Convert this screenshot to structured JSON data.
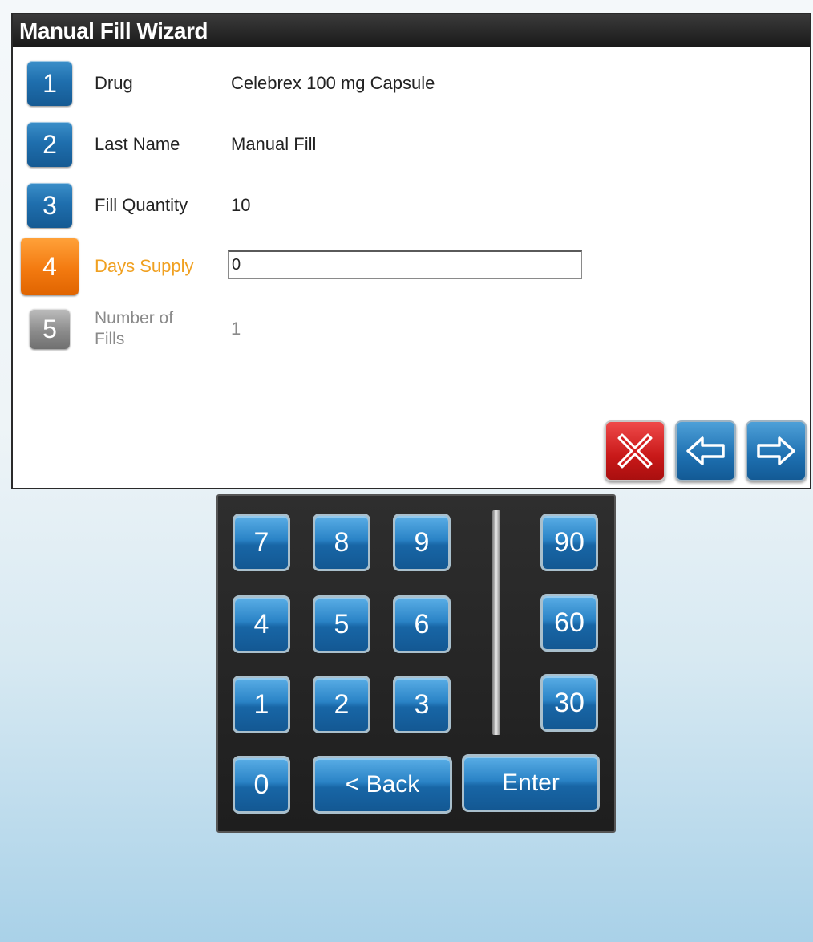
{
  "wizard": {
    "title": "Manual Fill Wizard",
    "steps": [
      {
        "number": "1",
        "label": "Drug",
        "value": "Celebrex 100 mg Capsule",
        "state": "complete"
      },
      {
        "number": "2",
        "label": "Last Name",
        "value": "Manual Fill",
        "state": "complete"
      },
      {
        "number": "3",
        "label": "Fill Quantity",
        "value": "10",
        "state": "complete"
      },
      {
        "number": "4",
        "label": "Days Supply",
        "value": "0",
        "state": "active"
      },
      {
        "number": "5",
        "label": "Number of Fills",
        "value": "1",
        "state": "disabled"
      }
    ],
    "nav": {
      "cancel_icon": "close-x-icon",
      "back_icon": "arrow-left-icon",
      "next_icon": "arrow-right-icon"
    }
  },
  "keypad": {
    "digits": [
      "7",
      "8",
      "9",
      "4",
      "5",
      "6",
      "1",
      "2",
      "3",
      "0"
    ],
    "presets": [
      "90",
      "60",
      "30"
    ],
    "back_label": "< Back",
    "enter_label": "Enter"
  },
  "colors": {
    "step_complete": "#1f6fae",
    "step_active": "#f37a10",
    "step_disabled": "#8c8c8c",
    "cancel": "#c81818"
  }
}
